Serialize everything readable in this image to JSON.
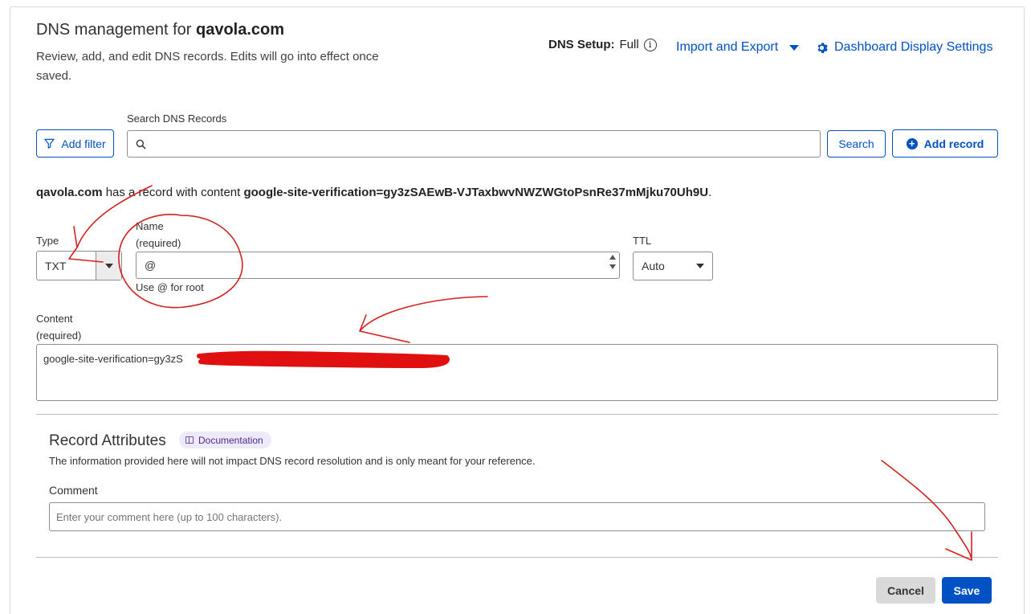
{
  "header": {
    "title_prefix": "DNS management for ",
    "domain": "qavola.com",
    "subtitle": "Review, add, and edit DNS records. Edits will go into effect once saved.",
    "dns_setup_label": "DNS Setup:",
    "dns_setup_value": "Full",
    "import_export_label": "Import and Export",
    "dashboard_settings_label": "Dashboard Display Settings"
  },
  "toolbar": {
    "add_filter_label": "Add filter",
    "search_label": "Search DNS Records",
    "search_value": "",
    "search_button_label": "Search",
    "add_record_label": "Add record"
  },
  "record_summary": {
    "domain": "qavola.com",
    "middle_text": " has a record with content ",
    "content": "google-site-verification=gy3zSAEwB-VJTaxbwvNWZWGtoPsnRe37mMjku70Uh9U",
    "end": "."
  },
  "form": {
    "type_label": "Type",
    "type_value": "TXT",
    "name_label": "Name",
    "name_required": "(required)",
    "name_value": "@",
    "name_help": "Use @ for root",
    "ttl_label": "TTL",
    "ttl_value": "Auto",
    "content_label": "Content",
    "content_required": "(required)",
    "content_visible_prefix": "google-site-verification=gy3zS"
  },
  "attributes": {
    "title": "Record Attributes",
    "doc_label": "Documentation",
    "description": "The information provided here will not impact DNS record resolution and is only meant for your reference.",
    "comment_label": "Comment",
    "comment_placeholder": "Enter your comment here (up to 100 characters)."
  },
  "footer": {
    "cancel_label": "Cancel",
    "save_label": "Save"
  },
  "colors": {
    "accent": "#0051c3",
    "annotation": "#d42020",
    "redaction": "#e01010"
  }
}
